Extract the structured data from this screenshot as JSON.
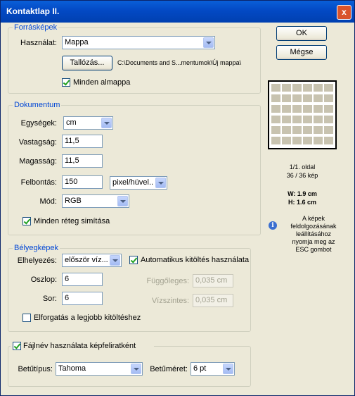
{
  "window": {
    "title": "Kontaktlap II.",
    "close_glyph": "x"
  },
  "buttons": {
    "ok": "OK",
    "cancel": "Mégse"
  },
  "source": {
    "legend": "Forrásképek",
    "use_label": "Használat:",
    "use_value": "Mappa",
    "browse_label": "Tallózás...",
    "path": "C:\\Documents and S...mentumok\\Új mappa\\",
    "subfolders_label": "Minden almappa",
    "subfolders_checked": true
  },
  "document": {
    "legend": "Dokumentum",
    "units_label": "Egységek:",
    "units_value": "cm",
    "width_label": "Vastagság:",
    "width_value": "11,5",
    "height_label": "Magasság:",
    "height_value": "11,5",
    "resolution_label": "Felbontás:",
    "resolution_value": "150",
    "resolution_unit": "pixel/hüvel..",
    "mode_label": "Mód:",
    "mode_value": "RGB",
    "flatten_label": "Minden réteg simítása",
    "flatten_checked": true
  },
  "thumbnails": {
    "legend": "Bélyegképek",
    "place_label": "Elhelyezés:",
    "place_value": "először víz...",
    "autofill_label": "Automatikus kitöltés használata",
    "autofill_checked": true,
    "columns_label": "Oszlop:",
    "columns_value": "6",
    "rows_label": "Sor:",
    "rows_value": "6",
    "vertical_label": "Függőleges:",
    "vertical_value": "0,035 cm",
    "horizontal_label": "Vízszintes:",
    "horizontal_value": "0,035 cm",
    "rotate_label": "Elforgatás a legjobb kitöltéshez",
    "rotate_checked": false
  },
  "caption": {
    "use_filename_label": "Fájlnév használata képfeliratként",
    "use_filename_checked": true,
    "font_label": "Betűtípus:",
    "font_value": "Tahoma",
    "size_label": "Betűméret:",
    "size_value": "6 pt"
  },
  "preview": {
    "pages": "1/1. oldal",
    "images": "36 / 36 kép",
    "w": "W: 1.9 cm",
    "h": "H: 1.6 cm",
    "grid_cols": 6,
    "grid_rows": 6,
    "info_icon": "info-icon",
    "info_text_1": "A képek",
    "info_text_2": "feldolgozásának",
    "info_text_3": "leállításához",
    "info_text_4": "nyomja meg az",
    "info_text_5": "ESC gombot"
  }
}
